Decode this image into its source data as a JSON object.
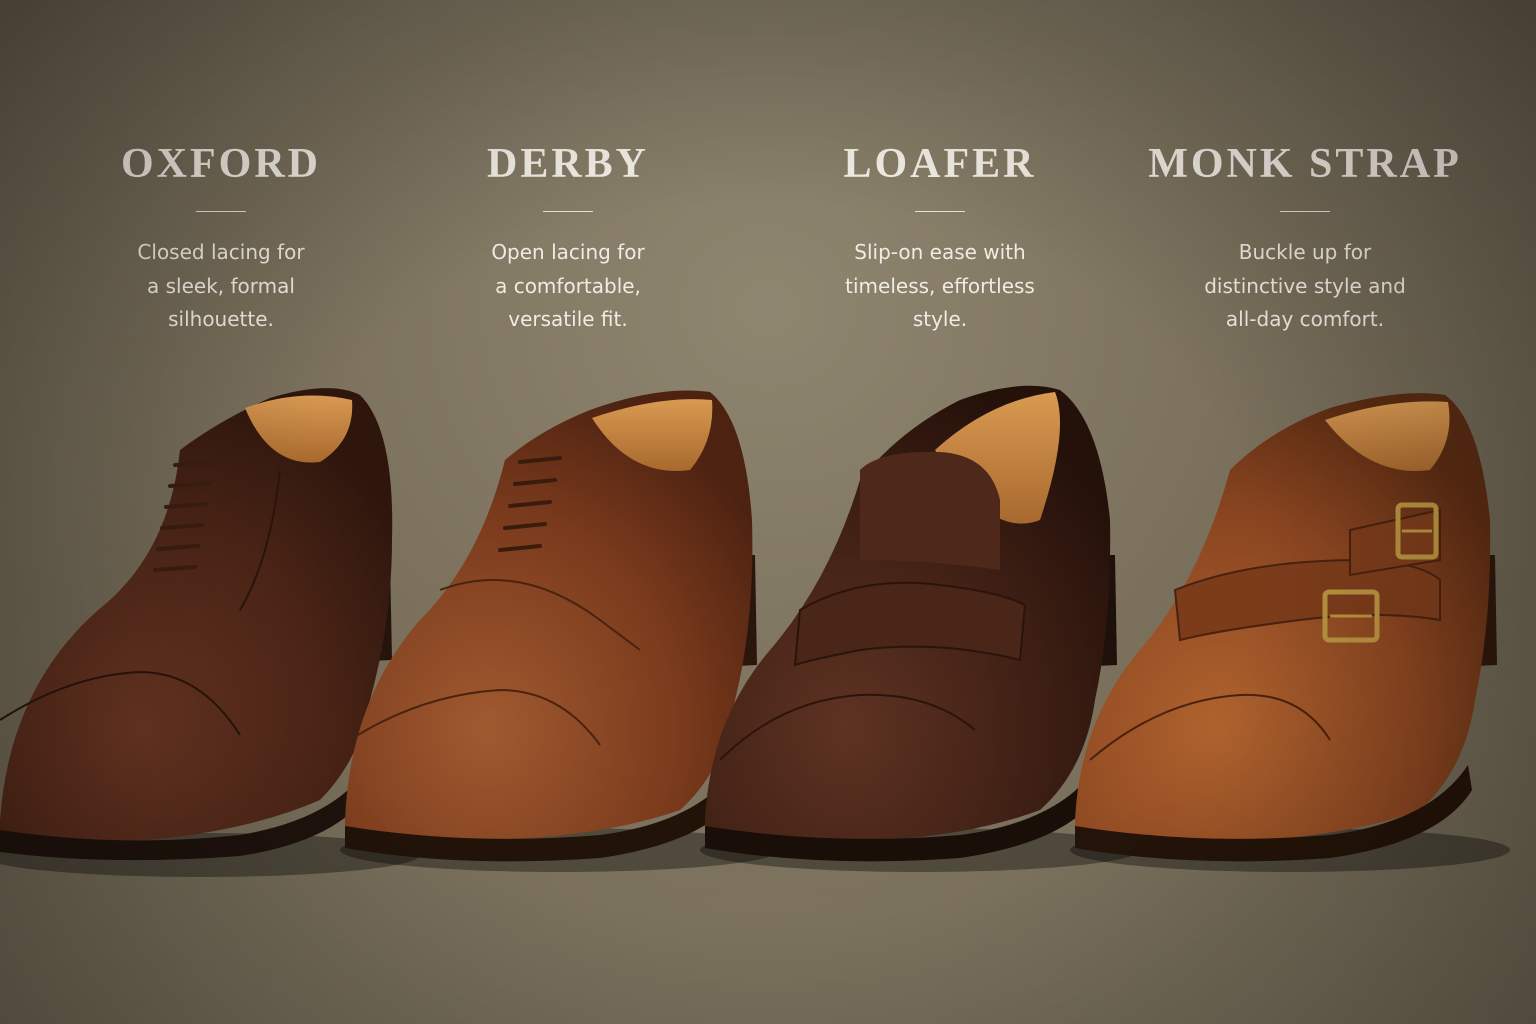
{
  "styles": [
    {
      "name": "OXFORD",
      "description": [
        "Closed lacing for",
        "a sleek, formal",
        "silhouette."
      ]
    },
    {
      "name": "DERBY",
      "description": [
        "Open lacing for",
        "a comfortable,",
        "versatile fit."
      ]
    },
    {
      "name": "LOAFER",
      "description": [
        "Slip-on ease with",
        "timeless, effortless",
        "style."
      ]
    },
    {
      "name": "MONK STRAP",
      "description": [
        "Buckle up for",
        "distinctive style and",
        "all-day comfort."
      ]
    }
  ],
  "colors": {
    "background": "#7a705c",
    "text": "#f4efe6",
    "oxford_leather": "#4a2416",
    "derby_leather": "#7a3a1c",
    "loafer_leather": "#3e1f14",
    "monk_leather": "#8a4520",
    "lining": "#c98a45",
    "sole": "#1e120c",
    "buckle": "#b8923f"
  }
}
